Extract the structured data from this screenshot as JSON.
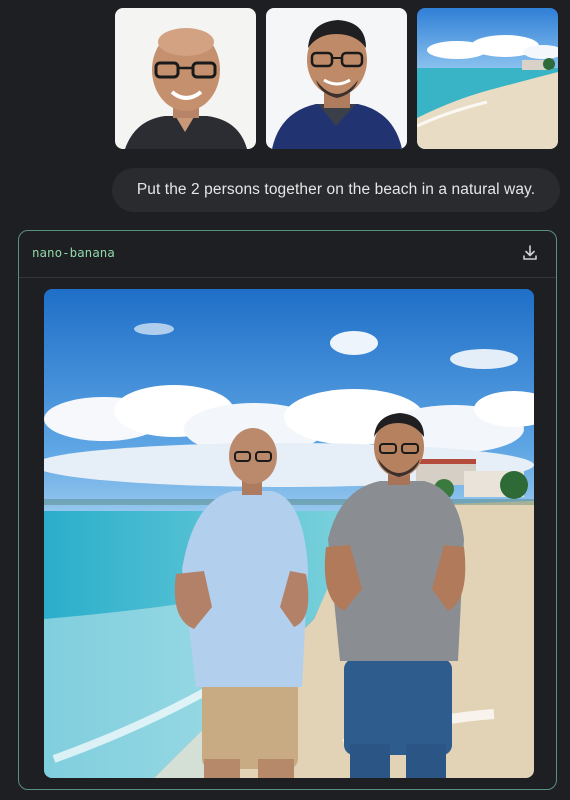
{
  "conversation": {
    "attachments": [
      {
        "name": "person-1-portrait",
        "icon": "photo"
      },
      {
        "name": "person-2-portrait",
        "icon": "photo"
      },
      {
        "name": "beach-photo",
        "icon": "photo"
      }
    ],
    "user_prompt": "Put the 2 persons together on the beach in a natural way.",
    "response": {
      "model_name": "nano-banana",
      "download_icon": "download-icon",
      "image": "generated-beach-photo"
    }
  },
  "colors": {
    "background": "#1e1f22",
    "bubble": "#2a2b2f",
    "card_border": "#5a8f78",
    "model_label": "#8fd6a8"
  }
}
